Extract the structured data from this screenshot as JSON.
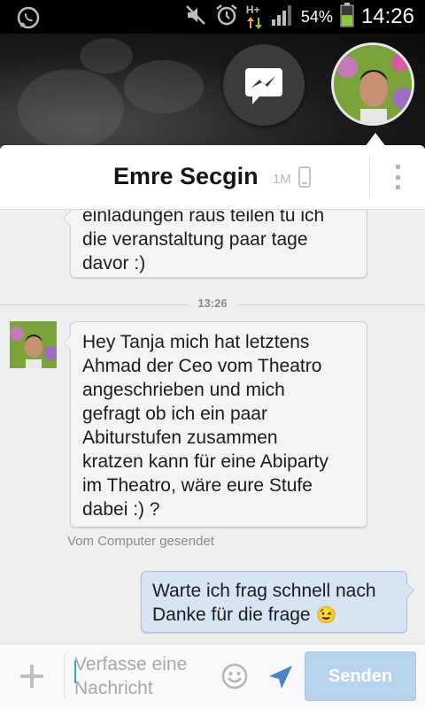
{
  "status_bar": {
    "battery_percent": "54%",
    "network_type": "H+",
    "time": "14:26",
    "icons": [
      "whatsapp-icon",
      "mute-icon",
      "alarm-icon",
      "data-arrows-icon",
      "signal-icon",
      "battery-icon"
    ],
    "battery_color": "#8ec63f"
  },
  "chat_heads": {
    "messenger_icon": "messenger-icon",
    "contact_avatar": "avatar"
  },
  "contact": {
    "name": "Emre Secgin",
    "presence": "1M",
    "presence_icon": "phone-icon",
    "menu_icon": "overflow-menu-icon"
  },
  "conversation": {
    "messages": [
      {
        "direction": "incoming",
        "text": "einladungen raus teilen tu ich\ndie veranstaltung paar tage\ndavor :)"
      },
      {
        "direction": "incoming",
        "text": "Hey Tanja mich hat letztens\nAhmad der Ceo vom Theatro\nangeschrieben und mich\ngefragt ob ich ein paar\nAbiturstufen zusammen\nkratzen kann für eine Abiparty\nim Theatro, wäre eure Stufe\ndabei :) ?",
        "note": "Vom Computer gesendet"
      },
      {
        "direction": "outgoing",
        "text": "Warte ich frag schnell nach\nDanke für die frage",
        "emoji": "😉"
      }
    ],
    "time_divider": "13:26"
  },
  "composer": {
    "placeholder": "Verfasse eine Nachricht",
    "value": "",
    "send_label": "Senden",
    "accent_color": "#35a7d6",
    "send_button_color": "#b9d3ef"
  }
}
